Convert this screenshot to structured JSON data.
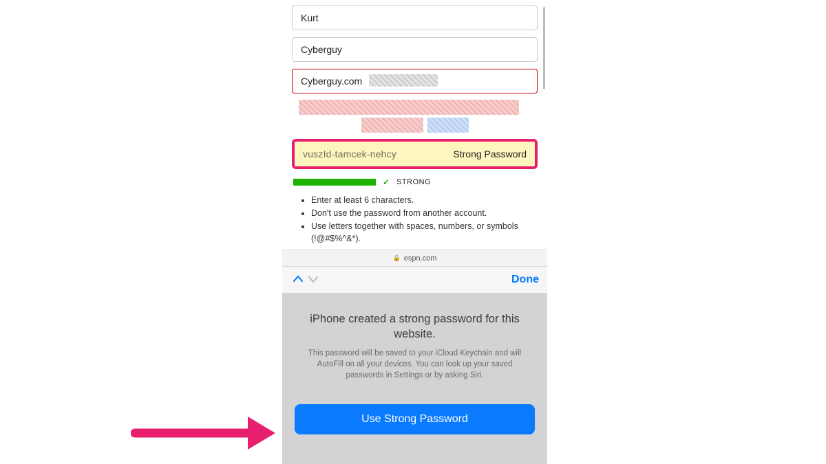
{
  "form": {
    "first_name": "Kurt",
    "last_name": "Cyberguy",
    "email_visible": "Cyberguy.com",
    "password_value": "vuszId-tamcek-nehcy",
    "password_badge": "Strong Password",
    "strength_label": "STRONG",
    "hints": [
      "Enter at least 6 characters.",
      "Don't use the password from another account.",
      "Use letters together with spaces, numbers, or symbols (!@#$%^&*)."
    ]
  },
  "browser": {
    "domain": "espn.com"
  },
  "accessory": {
    "done": "Done"
  },
  "keychain": {
    "title": "iPhone created a strong password for this website.",
    "subtitle": "This password will be saved to your iCloud Keychain and will AutoFill on all your devices. You can look up your saved passwords in Settings or by asking Siri.",
    "primary_button": "Use Strong Password"
  },
  "colors": {
    "accent_blue": "#0a7aff",
    "highlight_pink": "#e71f6e",
    "strength_green": "#1eb300"
  }
}
